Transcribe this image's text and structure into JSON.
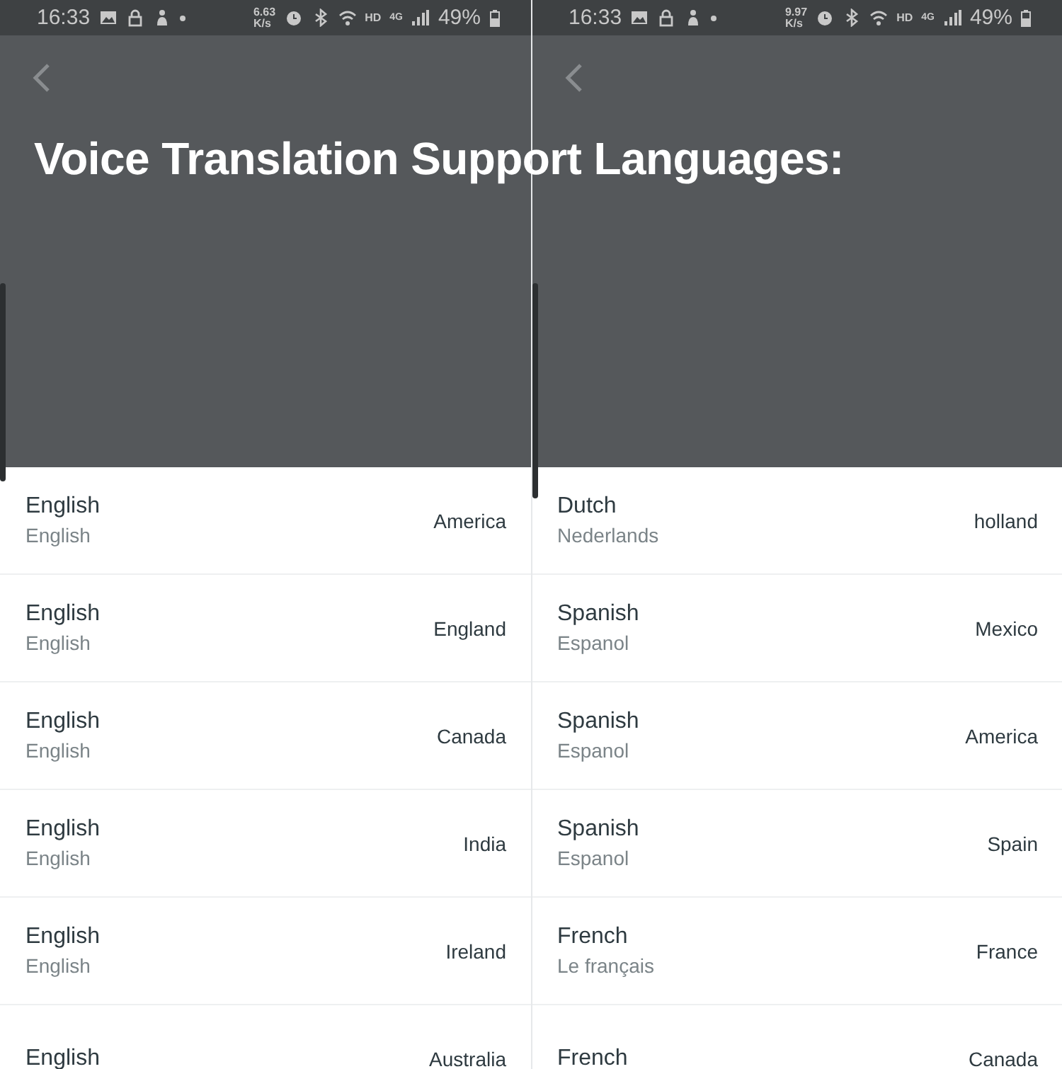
{
  "title": "Voice Translation Support Languages:",
  "panels": [
    {
      "status_bar": {
        "time": "16:33",
        "speed": "6.63",
        "speed_unit": "K/s",
        "hd": "HD",
        "network": "4G",
        "battery": "49%"
      },
      "rows": [
        {
          "language": "English",
          "native": "English",
          "region": "America"
        },
        {
          "language": "English",
          "native": "English",
          "region": "England"
        },
        {
          "language": "English",
          "native": "English",
          "region": "Canada"
        },
        {
          "language": "English",
          "native": "English",
          "region": "India"
        },
        {
          "language": "English",
          "native": "English",
          "region": "Ireland"
        },
        {
          "language": "English",
          "region": "Australia"
        }
      ]
    },
    {
      "status_bar": {
        "time": "16:33",
        "speed": "9.97",
        "speed_unit": "K/s",
        "hd": "HD",
        "network": "4G",
        "battery": "49%"
      },
      "rows": [
        {
          "language": "Dutch",
          "native": "Nederlands",
          "region": "holland"
        },
        {
          "language": "Spanish",
          "native": "Espanol",
          "region": "Mexico"
        },
        {
          "language": "Spanish",
          "native": "Espanol",
          "region": "America"
        },
        {
          "language": "Spanish",
          "native": "Espanol",
          "region": "Spain"
        },
        {
          "language": "French",
          "native": "Le français",
          "region": "France"
        },
        {
          "language": "French",
          "region": "Canada"
        }
      ]
    }
  ]
}
